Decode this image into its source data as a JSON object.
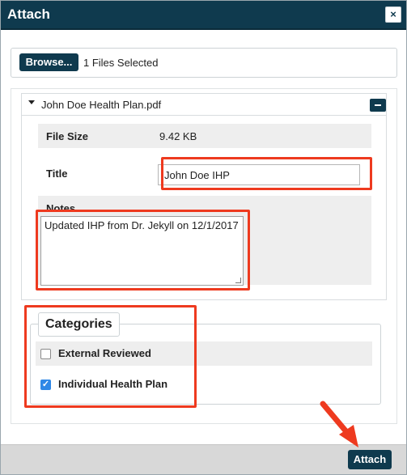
{
  "dialog": {
    "title": "Attach",
    "close_label": "×"
  },
  "upload": {
    "browse_label": "Browse...",
    "status": "1 Files Selected"
  },
  "file": {
    "name": "John Doe Health Plan.pdf",
    "size_label": "File Size",
    "size_value": "9.42 KB",
    "title_label": "Title",
    "title_value": "John Doe IHP",
    "notes_label": "Notes",
    "notes_value": "Updated IHP from Dr. Jekyll on 12/1/2017"
  },
  "categories": {
    "legend": "Categories",
    "items": [
      {
        "label": "External Reviewed",
        "checked": false
      },
      {
        "label": "Individual Health Plan",
        "checked": true
      }
    ]
  },
  "footer": {
    "attach_label": "Attach"
  },
  "annotation": {
    "highlight_color": "#ee3a1f"
  }
}
